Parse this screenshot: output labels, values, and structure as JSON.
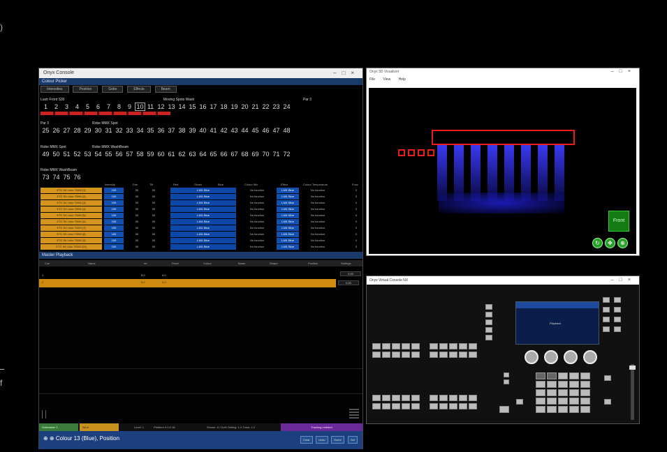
{
  "edge": {
    "glyph_top": ")",
    "glyph_bottom": "f"
  },
  "left_window": {
    "title": "Onyx Console",
    "fixture_panel_title": "Colour Picker",
    "tabs": [
      "Intensities",
      "Position",
      "Gobo",
      "Effects",
      "Beam"
    ],
    "groups": [
      {
        "label": "Lustr Front S30",
        "numbers": [
          1,
          2,
          3,
          4,
          5,
          6,
          7,
          8,
          9,
          10
        ]
      },
      {
        "label": "Moving Spots Wash",
        "numbers": [
          11,
          12,
          13,
          14,
          15,
          16,
          17,
          18,
          19,
          20
        ]
      },
      {
        "label": "Par 3",
        "numbers": [
          21,
          22,
          23,
          24
        ]
      }
    ],
    "row2_groups": [
      {
        "label": "Par 3",
        "numbers": [
          25,
          26,
          27,
          28
        ]
      },
      {
        "label": "Robe MMX Spot",
        "numbers": [
          29,
          30,
          31,
          32,
          33,
          34,
          35,
          36,
          37,
          38,
          39,
          40,
          41,
          42,
          43,
          44,
          45,
          46,
          47,
          48
        ]
      }
    ],
    "row3_groups": [
      {
        "label": "Robe MMX Spot",
        "numbers": [
          49,
          50,
          51,
          52
        ]
      },
      {
        "label": "Robe MMX WashBeam",
        "numbers": [
          53,
          54,
          55,
          56,
          57,
          58,
          59,
          60,
          61,
          62,
          63,
          64,
          65,
          66,
          67,
          68,
          69,
          70,
          71,
          72
        ]
      }
    ],
    "row4_groups": [
      {
        "label": "Robe MMX WashBeam",
        "numbers": [
          73,
          74,
          75,
          76
        ]
      }
    ],
    "sheet_headers": [
      "Intensity",
      "Pan",
      "Tilt",
      "Red",
      "Green",
      "Blue",
      "Colour Mix",
      "Effect",
      "Colour Temperature",
      "Func"
    ],
    "sheet_rows": [
      {
        "name": "ETC S4 Leko 750W [1]",
        "intensity": "100",
        "pan": "50",
        "tilt": "50",
        "colour": "L181 Blue",
        "func": "No function",
        "effect": "L181 Blue",
        "func2": "No function",
        "last": "0"
      },
      {
        "name": "ETC S4 Leko 750W [2]",
        "intensity": "100",
        "pan": "50",
        "tilt": "50",
        "colour": "L181 Blue",
        "func": "No function",
        "effect": "L181 Blue",
        "func2": "No function",
        "last": "0"
      },
      {
        "name": "ETC S4 Leko 750W [3]",
        "intensity": "100",
        "pan": "50",
        "tilt": "50",
        "colour": "L181 Blue",
        "func": "No function",
        "effect": "L181 Blue",
        "func2": "No function",
        "last": "0"
      },
      {
        "name": "ETC S4 Leko 750W [4]",
        "intensity": "100",
        "pan": "50",
        "tilt": "50",
        "colour": "L181 Blue",
        "func": "No function",
        "effect": "L181 Blue",
        "func2": "No function",
        "last": "0"
      },
      {
        "name": "ETC S4 Leko 750W [5]",
        "intensity": "100",
        "pan": "50",
        "tilt": "50",
        "colour": "L181 Blue",
        "func": "No function",
        "effect": "L181 Blue",
        "func2": "No function",
        "last": "0"
      },
      {
        "name": "ETC S4 Leko 750W [6]",
        "intensity": "100",
        "pan": "50",
        "tilt": "50",
        "colour": "L181 Blue",
        "func": "No function",
        "effect": "L181 Blue",
        "func2": "No function",
        "last": "0"
      },
      {
        "name": "ETC S4 Leko 750W [7]",
        "intensity": "100",
        "pan": "50",
        "tilt": "50",
        "colour": "L181 Blue",
        "func": "No function",
        "effect": "L181 Blue",
        "func2": "No function",
        "last": "0"
      },
      {
        "name": "ETC S4 Leko 750W [8]",
        "intensity": "100",
        "pan": "50",
        "tilt": "50",
        "colour": "L181 Blue",
        "func": "No function",
        "effect": "L181 Blue",
        "func2": "No function",
        "last": "0"
      },
      {
        "name": "ETC S4 Leko 750W [9]",
        "intensity": "100",
        "pan": "50",
        "tilt": "50",
        "colour": "L181 Blue",
        "func": "No function",
        "effect": "L181 Blue",
        "func2": "No function",
        "last": "0"
      },
      {
        "name": "ETC S4 Leko 750W [10]",
        "intensity": "100",
        "pan": "50",
        "tilt": "50",
        "colour": "L181 Blue",
        "func": "No function",
        "effect": "L181 Blue",
        "func2": "No function",
        "last": "0"
      }
    ],
    "playback_title": "Master Playback",
    "playback_cols": [
      "Cue",
      "Name",
      "Int",
      "Fixed",
      "Colour",
      "Beam",
      "Shape",
      "Position",
      "Settings"
    ],
    "playback_row1": {
      "cue": "1",
      "int": "5.0",
      "fixed": "0.0",
      "side": "0.00"
    },
    "playback_row2": {
      "cue": "2",
      "int": "5.0",
      "fixed": "0.0",
      "side": "0.00"
    },
    "status": {
      "submaster": "Submaster 1",
      "mode": "Blind",
      "level": "Level: 1",
      "platform": "Platform 4.0.0.18",
      "info": "Shows: 11 Cloth Setting: 1.0 Track: 1.0",
      "tracking": "Tracking enabled"
    },
    "command_line": "Colour 13 (Blue), Position",
    "cmd_buttons": [
      "Clear",
      "Undo",
      "Home",
      "Set"
    ]
  },
  "viewer_window": {
    "title": "Onyx 3D Visualizer",
    "menu": [
      "File",
      "View",
      "Help"
    ],
    "front_label": "Front",
    "nav_icons": [
      "orbit-icon",
      "pan-icon",
      "zoom-icon"
    ]
  },
  "console_window": {
    "title": "Onyx Virtual Console NX",
    "screen_text": "Playback"
  },
  "colors": {
    "accent_orange": "#d4941e",
    "accent_blue": "#1150b0",
    "truss_red": "#e81c1c",
    "status_green": "#3a7a3a",
    "status_purple": "#6a2a9a"
  }
}
